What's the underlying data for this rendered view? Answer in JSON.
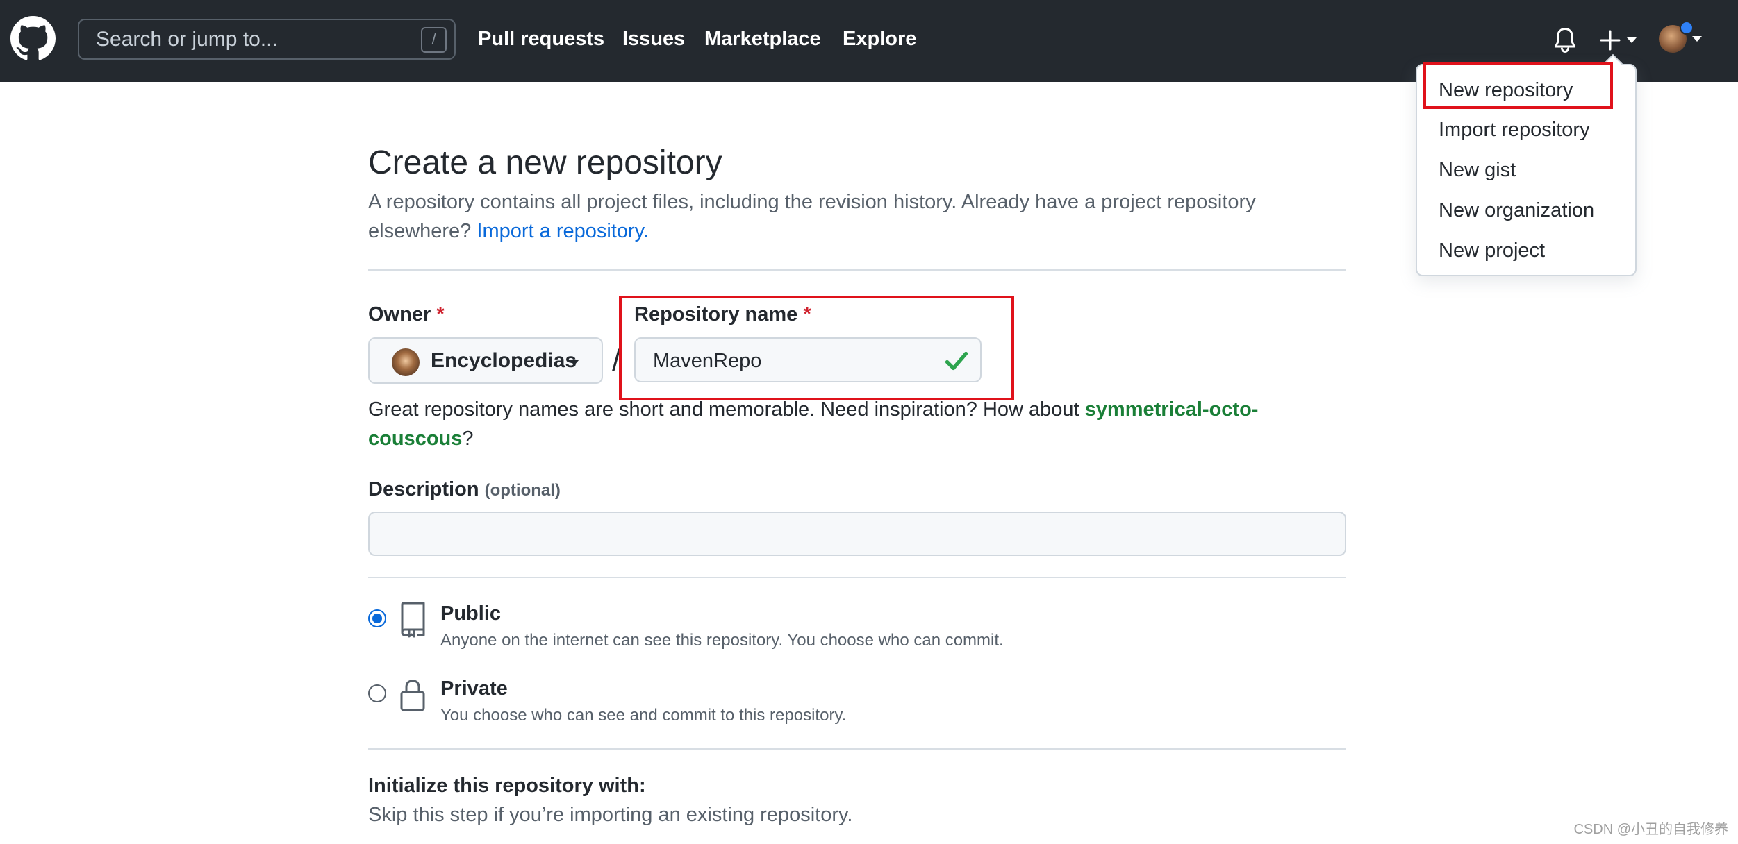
{
  "header": {
    "search_placeholder": "Search or jump to...",
    "search_shortcut": "/",
    "nav": [
      "Pull requests",
      "Issues",
      "Marketplace",
      "Explore"
    ]
  },
  "create_menu": {
    "items": [
      "New repository",
      "Import repository",
      "New gist",
      "New organization",
      "New project"
    ]
  },
  "page": {
    "title": "Create a new repository",
    "subtitle": "A repository contains all project files, including the revision history. Already have a project repository elsewhere?",
    "import_link": "Import a repository.",
    "owner_label": "Owner",
    "required_mark": "*",
    "owner_value": "Encyclopedias",
    "separator": "/",
    "repo_name_label": "Repository name",
    "repo_name_value": "MavenRepo",
    "hint_prefix": "Great repository names are short and memorable. Need inspiration? How about",
    "hint_suggestion": "symmetrical-octo-couscous",
    "hint_suffix": "?",
    "description_label": "Description",
    "description_optional": "(optional)",
    "description_value": "",
    "visibility": {
      "selected": "Public",
      "options": [
        {
          "title": "Public",
          "desc": "Anyone on the internet can see this repository. You choose who can commit."
        },
        {
          "title": "Private",
          "desc": "You choose who can see and commit to this repository."
        }
      ]
    },
    "init_title": "Initialize this repository with:",
    "init_desc": "Skip this step if you’re importing an existing repository."
  },
  "watermark": "CSDN @小丑的自我修养",
  "colors": {
    "header_bg": "#24292f",
    "link": "#0969da",
    "suggestion": "#1a7f37",
    "required": "#cf222e",
    "highlight_box": "#e0121b",
    "check": "#2da44e"
  }
}
